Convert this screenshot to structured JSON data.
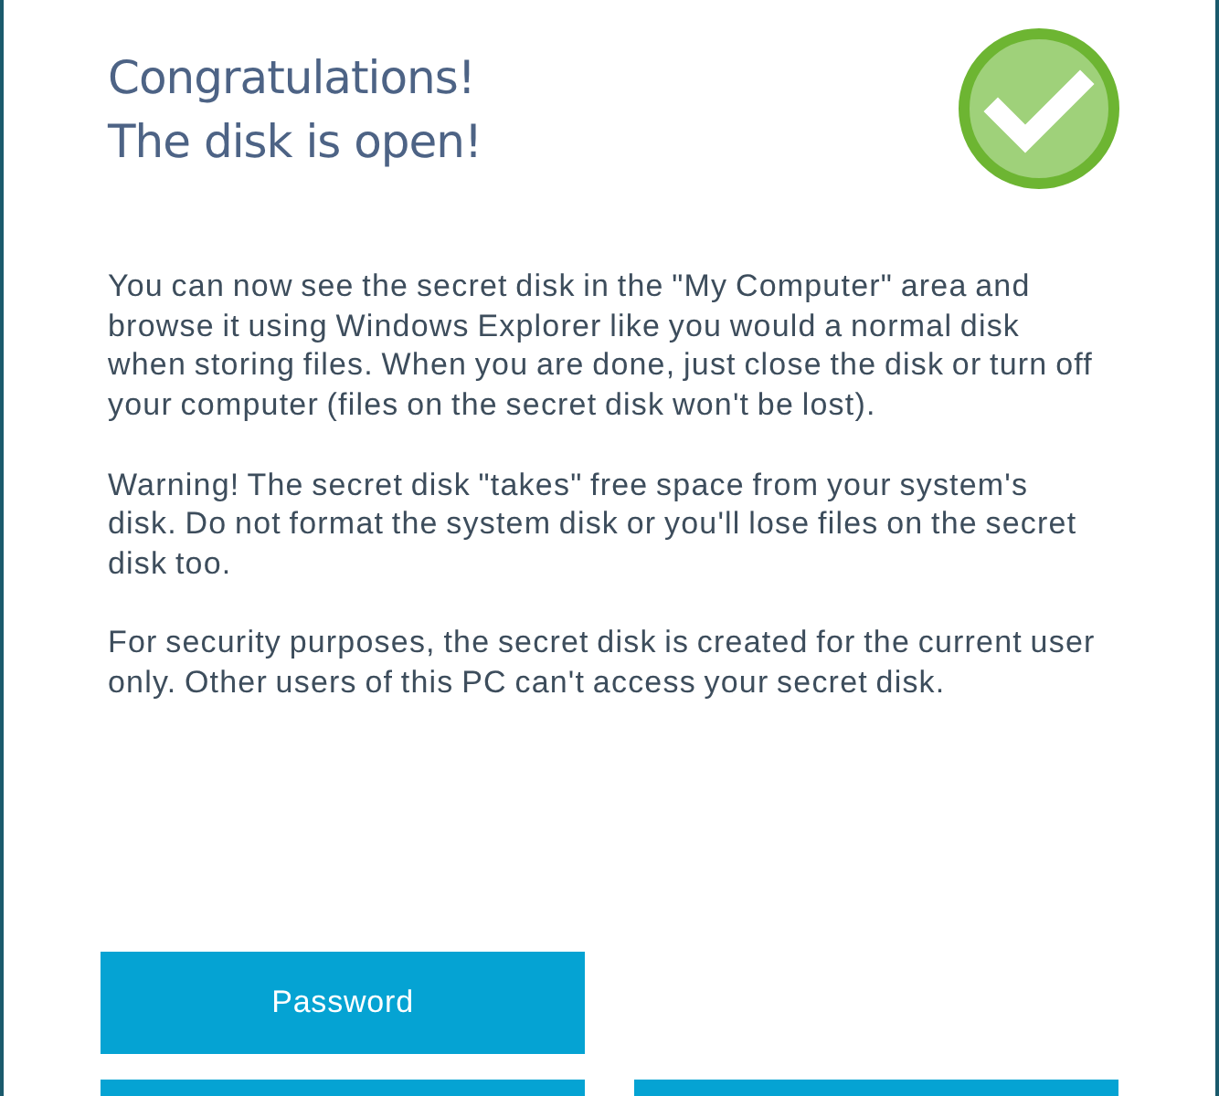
{
  "dialog": {
    "title": [
      "Congratulations!",
      "The disk is open!"
    ],
    "paragraphs": [
      "You can now see the secret disk in the \"My Computer\" area and browse it using Windows Explorer like you would a normal disk when storing files. When you are done, just close the disk or turn off your computer (files on the secret disk won't be lost).",
      "Warning! The secret disk \"takes\" free space from your system's disk. Do not format the system disk or you'll lose files on the secret disk too.",
      "For security purposes, the secret disk is created for the current user only. Other users of this PC can't access your secret disk."
    ],
    "button_rows": [
      {
        "buttons": [
          {
            "label": "Password",
            "clipped": false
          }
        ]
      },
      {
        "buttons": [
          {
            "clipped": true
          },
          {
            "clipped": true
          }
        ]
      }
    ]
  }
}
